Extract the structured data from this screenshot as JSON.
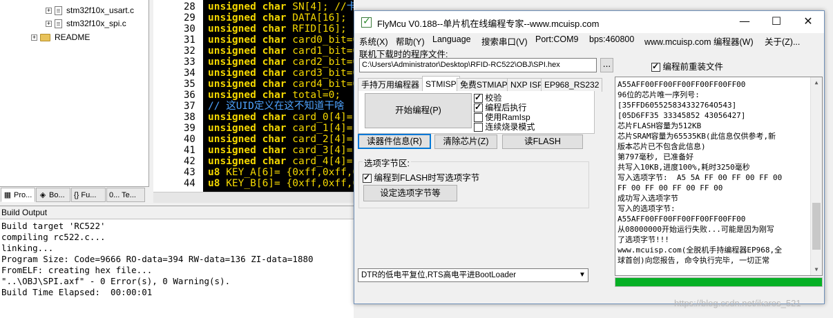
{
  "tree": {
    "items": [
      {
        "label": "stm32f10x_usart.c",
        "type": "file"
      },
      {
        "label": "stm32f10x_spi.c",
        "type": "file"
      },
      {
        "label": "README",
        "type": "folder"
      }
    ]
  },
  "left_tabs": [
    {
      "label": "Pro...",
      "icon": "project-icon"
    },
    {
      "label": "Bo...",
      "icon": "books-icon"
    },
    {
      "label": "{} Fu...",
      "icon": "functions-icon"
    },
    {
      "label": "0... Te...",
      "icon": "templates-icon"
    }
  ],
  "editor": {
    "lines": [
      {
        "num": "28",
        "kw": "unsigned char ",
        "rest": "SN[4]; //",
        "cm": "卡号"
      },
      {
        "num": "29",
        "kw": "unsigned char ",
        "rest": "DATA[16];",
        "cm": ""
      },
      {
        "num": "30",
        "kw": "unsigned char ",
        "rest": "RFID[16];",
        "cm": ""
      },
      {
        "num": "31",
        "kw": "unsigned char ",
        "rest": "card0_bit=0",
        "cm": ""
      },
      {
        "num": "32",
        "kw": "unsigned char ",
        "rest": "card1_bit=0",
        "cm": ""
      },
      {
        "num": "33",
        "kw": "unsigned char ",
        "rest": "card2_bit=0",
        "cm": ""
      },
      {
        "num": "34",
        "kw": "unsigned char ",
        "rest": "card3_bit=0",
        "cm": ""
      },
      {
        "num": "35",
        "kw": "unsigned char ",
        "rest": "card4_bit=0",
        "cm": ""
      },
      {
        "num": "36",
        "kw": "unsigned char ",
        "rest": "total=0;",
        "cm": ""
      },
      {
        "num": "37",
        "kw": "",
        "rest": "",
        "cm": "// 这UID定义在这不知道干啥"
      },
      {
        "num": "38",
        "kw": "unsigned char ",
        "rest": "card_0[4]=",
        "cm": ""
      },
      {
        "num": "39",
        "kw": "unsigned char ",
        "rest": "card_1[4]=",
        "cm": ""
      },
      {
        "num": "40",
        "kw": "unsigned char ",
        "rest": "card_2[4]=",
        "cm": ""
      },
      {
        "num": "41",
        "kw": "unsigned char ",
        "rest": "card_3[4]=",
        "cm": ""
      },
      {
        "num": "42",
        "kw": "unsigned char ",
        "rest": "card_4[4]=",
        "cm": ""
      },
      {
        "num": "43",
        "kw": "u8 ",
        "rest": "KEY_A[6]= {0xff,0xff,0x",
        "cm": ""
      },
      {
        "num": "44",
        "kw": "u8 ",
        "rest": "KEY_B[6]= {0xff,0xff,0x",
        "cm": ""
      }
    ]
  },
  "build": {
    "title": "Build Output",
    "lines": [
      "Build target 'RC522'",
      "compiling rc522.c...",
      "linking...",
      "Program Size: Code=9666 RO-data=394 RW-data=136 ZI-data=1880",
      "FromELF: creating hex file...",
      "\"..\\OBJ\\SPI.axf\" - 0 Error(s), 0 Warning(s).",
      "Build Time Elapsed:  00:00:01"
    ]
  },
  "flymcu": {
    "title": "FlyMcu V0.188--单片机在线编程专家--www.mcuisp.com",
    "win_controls": {
      "minimize": "—",
      "maximize": "☐",
      "close": "✕"
    },
    "menu": [
      "系统(X)",
      "帮助(Y)",
      "Language",
      "搜索串口(V)",
      "Port:COM9",
      "bps:460800",
      "www.mcuisp.com 编程器(W)",
      "关于(Z)..."
    ],
    "file_label": "联机下载时的程序文件:",
    "file_path": "C:\\Users\\Administrator\\Desktop\\RFID-RC522\\OBJ\\SPI.hex",
    "browse_label": "...",
    "reload_label": "编程前重装文件",
    "reload_checked": true,
    "tabs": [
      "手持万用编程器",
      "STMISP",
      "免费STMIAP",
      "NXP ISP",
      "EP968_RS232"
    ],
    "active_tab": "STMISP",
    "start_button": "开始编程(P)",
    "options": [
      {
        "label": "校验",
        "checked": true
      },
      {
        "label": "编程后执行",
        "checked": true
      },
      {
        "label": "使用RamIsp",
        "checked": false
      },
      {
        "label": "连续烧录模式",
        "checked": false
      }
    ],
    "read_info_button": "读器件信息(R)",
    "erase_button": "清除芯片(Z)",
    "read_flash_button": "读FLASH",
    "option_group_label": "选项字节区:",
    "write_option_label": "编程到FLASH时写选项字节",
    "write_option_checked": true,
    "set_option_button": "设定选项字节等",
    "boot_select": "DTR的低电平复位,RTS高电平进BootLoader",
    "log_lines": [
      "A55AFF00FF00FF00FF00FF00FF00",
      "96位的芯片唯一序列号:",
      "[35FFD605525834332764O543]",
      "[05D6FF35 33345852 43056427]",
      "芯片FLASH容量为512KB",
      "芯片SRAM容量为65535KB(此信息仅供参考,新",
      "版本芯片已不包含此信息)",
      "第797毫秒, 已准备好",
      "共写入10KB,进度100%,耗时3250毫秒",
      "写入选项字节:  A5 5A FF 00 FF 00 FF 00",
      "FF 00 FF 00 FF 00 FF 00",
      "成功写入选项字节",
      "写入的选项字节:",
      "A55AFF00FF00FF00FF00FF00FF00",
      "从08000000开始运行失败...可能是因为刚写",
      "了选项字节!!!",
      "www.mcuisp.com(全脱机手持编程器EP968,全",
      "球首创)向您报告, 命令执行完毕, 一切正常"
    ],
    "progress": 1.0
  },
  "watermark": "https://blog.csdn.net/ikaros_521"
}
